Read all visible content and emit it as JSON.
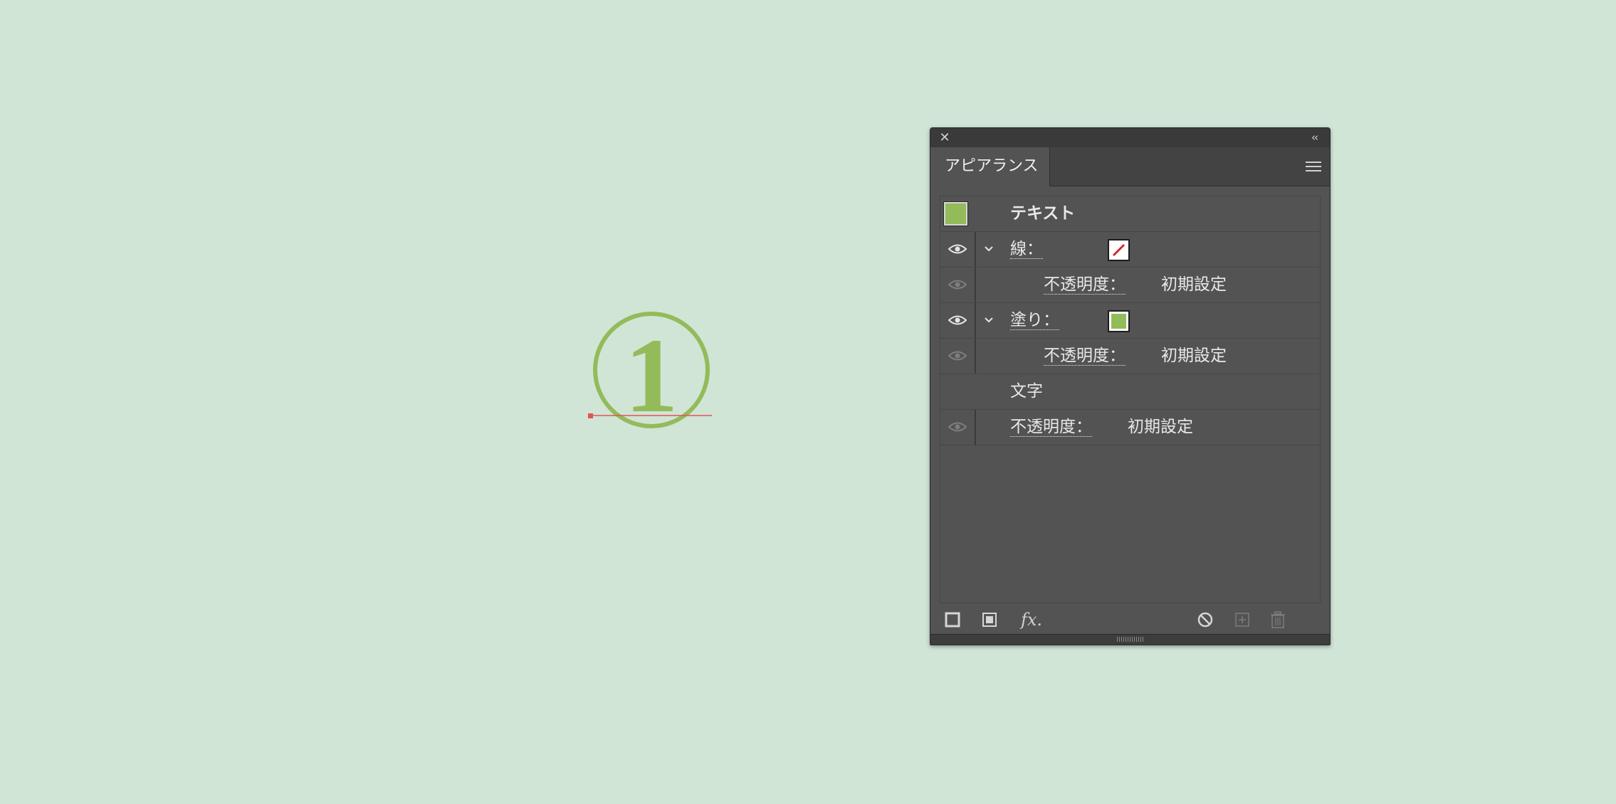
{
  "artwork": {
    "glyph": "1",
    "color": "#93bb5a",
    "baseline_color": "#e05555"
  },
  "panel": {
    "tab_title": "アピアランス",
    "close_glyph": "✕",
    "collapse_glyph": "‹‹",
    "rows": [
      {
        "id": "text",
        "label": "テキスト"
      },
      {
        "id": "stroke",
        "label": "線：",
        "swatch": "none"
      },
      {
        "id": "stroke-opacity",
        "label": "不透明度：",
        "value": "初期設定"
      },
      {
        "id": "fill",
        "label": "塗り：",
        "swatch": "#93bb5a"
      },
      {
        "id": "fill-opacity",
        "label": "不透明度：",
        "value": "初期設定"
      },
      {
        "id": "characters",
        "label": "文字"
      },
      {
        "id": "object-opacity",
        "label": "不透明度：",
        "value": "初期設定"
      }
    ],
    "footer": {
      "fx_label": "fx."
    }
  },
  "colors": {
    "panel_bg": "#535353",
    "titlebar_bg": "#3a3a3a",
    "accent_fill": "#93bb5a",
    "none_slash": "#d42a2a",
    "canvas_bg": "#d0e5d6"
  },
  "icons": [
    "close-icon",
    "collapse-icon",
    "panel-menu-icon",
    "eye-icon",
    "chevron-down-icon",
    "add-stroke-icon",
    "add-fill-icon",
    "fx-icon",
    "clear-appearance-icon",
    "duplicate-item-icon",
    "delete-item-icon"
  ]
}
